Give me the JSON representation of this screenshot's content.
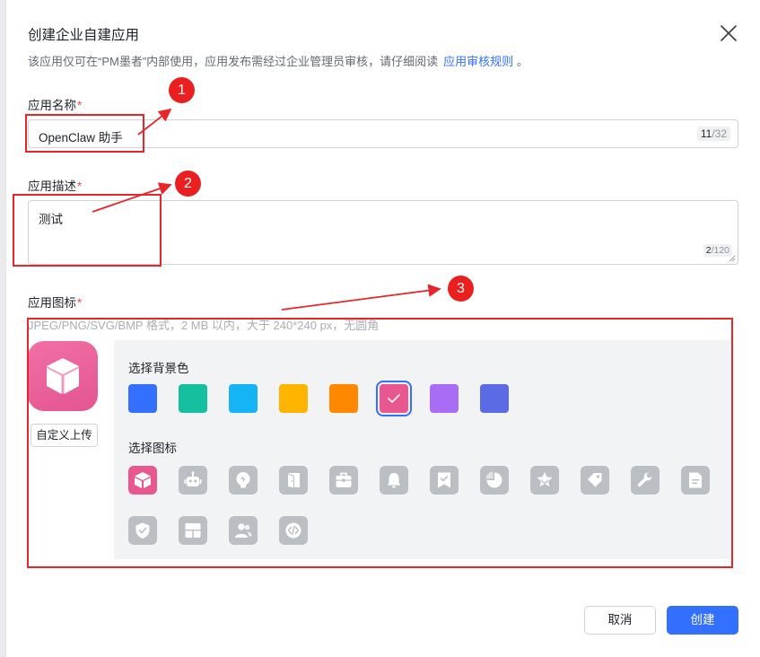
{
  "dialog": {
    "title": "创建企业自建应用",
    "subtitle": "该应用仅可在“PM墨者”内部使用，应用发布需经过企业管理员审核，请仔细阅读",
    "subtitle_link": "应用审核规则",
    "subtitle_end": "。"
  },
  "name_field": {
    "label": "应用名称",
    "required_mark": "*",
    "value": "OpenClaw 助手",
    "count": "11",
    "max": "/32"
  },
  "desc_field": {
    "label": "应用描述",
    "required_mark": "*",
    "value": "测试",
    "count": "2",
    "max": "/120"
  },
  "icon_field": {
    "label": "应用图标",
    "required_mark": "*",
    "hint": "JPEG/PNG/SVG/BMP 格式，2 MB 以内，大于 240*240 px，无圆角",
    "upload_label": "自定义上传",
    "bg_section_label": "选择背景色",
    "icon_section_label": "选择图标",
    "bg_colors": [
      "#3370ff",
      "#14c0a0",
      "#14b4f5",
      "#ffb400",
      "#ff8800",
      "#e8578f",
      "#a86cf5",
      "#5b6ae5"
    ],
    "selected_bg": "#e8578f",
    "icons": [
      "cube-icon",
      "robot-icon",
      "lightbulb-icon",
      "door-icon",
      "briefcase-icon",
      "bell-icon",
      "bookmark-check-icon",
      "pie-chart-icon",
      "star-badge-icon",
      "tag-icon",
      "wrench-icon",
      "document-icon",
      "shield-check-icon",
      "layout-icon",
      "users-icon",
      "code-icon"
    ],
    "selected_icon": "cube-icon"
  },
  "annotations": [
    "1",
    "2",
    "3"
  ],
  "annotation_color": "#e8262a",
  "footer": {
    "cancel_label": "取消",
    "create_label": "创建"
  }
}
